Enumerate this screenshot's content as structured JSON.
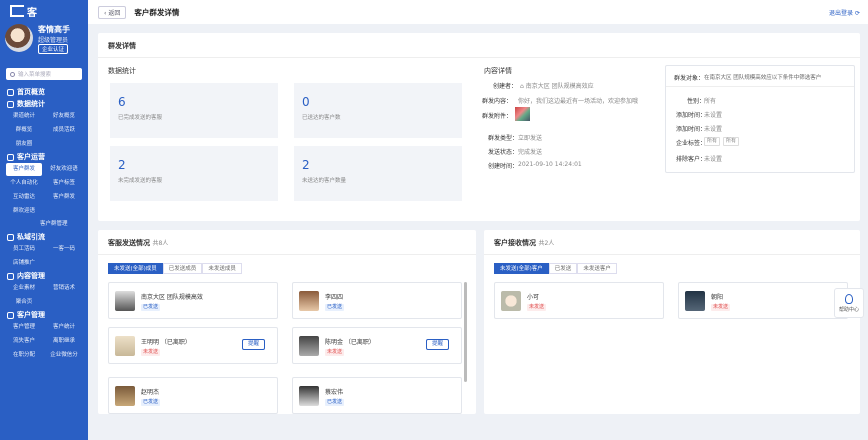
{
  "sidebar": {
    "logo": "客",
    "profile": {
      "name": "客情高手",
      "role": "超级管理员",
      "badge": "企业认证"
    },
    "search_placeholder": "输入菜单搜索",
    "home": "首页概览",
    "sec1": {
      "title": "数据统计",
      "items": [
        "渠道统计",
        "好友概览",
        "群概览",
        "成员活跃",
        "朋友圈"
      ]
    },
    "sec2": {
      "title": "客户运营",
      "items": [
        "客户群发",
        "好友欢迎语",
        "个人自动化",
        "客户标签",
        "互动雷达",
        "客户群发",
        "群欢迎语",
        "客户群管理"
      ],
      "active": 0
    },
    "sec3": {
      "title": "私域引流",
      "items": [
        "员工活码",
        "一客一码",
        "店铺推广"
      ]
    },
    "sec4": {
      "title": "内容管理",
      "items": [
        "企业素材",
        "营销话术",
        "聚合页"
      ]
    },
    "sec5": {
      "title": "客户管理",
      "items": [
        "客户管理",
        "客户统计",
        "流失客户",
        "离职继承",
        "在职分配",
        "企业微信分"
      ]
    }
  },
  "topbar": {
    "back": "返回",
    "title": "客户群发详情",
    "exit": "退出登录"
  },
  "detail": {
    "title": "群发详情",
    "stats_title": "数据统计",
    "stats": [
      {
        "value": "6",
        "label": "已完成发送的客服"
      },
      {
        "value": "0",
        "label": "已送达的客户数"
      },
      {
        "value": "2",
        "label": "未完成发送的客服"
      },
      {
        "value": "2",
        "label": "未送达的客户数量"
      }
    ],
    "info_title": "内容详情",
    "creator_label": "创建者：",
    "creator": "南京大区 团队规模高效应",
    "content_label": "群发内容：",
    "content": "你好，我们这边最近有一场活动，欢迎参加哦",
    "attach_label": "群发附件：",
    "type_label": "群发类型：",
    "type": "立即发送",
    "status_label": "发送状态：",
    "status": "完成发送",
    "time_label": "创建时间：",
    "time": "2021-09-10 14:24:01",
    "target_label": "群发对象：",
    "target": "在南京大区 团队规模高效应以下条件中筛选客户",
    "sex_label": "性别：",
    "sex": "所有",
    "add_label": "添加时间：",
    "add": "未设置",
    "addtime_label": "添加时间：",
    "addtime": "未设置",
    "tags_label": "企业标签：",
    "tags": [
      "所有",
      "所有"
    ],
    "exclude_label": "排除客户：",
    "exclude": "未设置"
  },
  "staff": {
    "title": "客服发送情况",
    "count": "共8人",
    "tabs": [
      "未发送(全部)成员",
      "已发送成员",
      "未发送成员"
    ],
    "members": [
      {
        "name": "南京大区 团队规模高效",
        "tag": "已发送",
        "tag_color": "#2a5fc4"
      },
      {
        "name": "李四四",
        "tag": "已发送",
        "tag_color": "#2a5fc4"
      },
      {
        "name": "王明明 （已离职）",
        "tag": "未发送",
        "tag_color": "#e05050",
        "remind": "提醒"
      },
      {
        "name": "陈明金 （已离职）",
        "tag": "未发送",
        "tag_color": "#e05050",
        "remind": "提醒"
      },
      {
        "name": "赵明杰",
        "tag": "已发送",
        "tag_color": "#2a5fc4"
      },
      {
        "name": "蔡宏伟",
        "tag": "已发送",
        "tag_color": "#2a5fc4"
      }
    ]
  },
  "customer": {
    "title": "客户接收情况",
    "count": "共2人",
    "tabs": [
      "未发送(全部)客户",
      "已发送",
      "未发送客户"
    ],
    "members": [
      {
        "name": "小可",
        "tag": "未发送",
        "tag_color": "#e05050"
      },
      {
        "name": "朝阳",
        "tag": "未发送",
        "tag_color": "#e05050"
      }
    ]
  },
  "float": {
    "label": "帮助中心"
  }
}
